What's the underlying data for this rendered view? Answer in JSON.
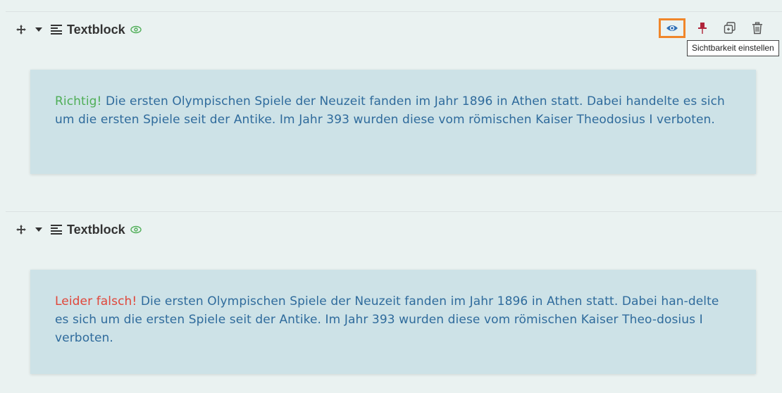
{
  "colors": {
    "accent": "#f0862a",
    "correct": "#4fae57",
    "wrong": "#e0463a",
    "text": "#2f6b9c",
    "card": "#cde2e7"
  },
  "blocks": [
    {
      "title": "Textblock",
      "icons": [
        "move-icon",
        "chevron-down-icon",
        "paragraph-icon",
        "eye-icon"
      ],
      "prefix": "Richtig!",
      "text": " Die ersten Olympischen Spiele der Neuzeit fanden im Jahr 1896 in Athen statt. Dabei handelte es sich um die ersten Spiele seit der Antike. Im Jahr 393 wurden diese vom römischen Kaiser Theodosius I verboten.",
      "toolbar": [
        "eye-icon",
        "pin-icon",
        "copy-icon",
        "trash-icon"
      ],
      "tooltip": "Sichtbarkeit einstellen"
    },
    {
      "title": "Textblock",
      "icons": [
        "move-icon",
        "chevron-down-icon",
        "paragraph-icon",
        "eye-icon"
      ],
      "prefix": "Leider falsch!",
      "text": " Die ersten Olympischen Spiele der Neuzeit fanden im Jahr 1896 in Athen statt. Dabei han-delte es sich um die ersten Spiele seit der Antike. Im Jahr 393 wurden diese vom römischen Kaiser Theo-dosius I verboten."
    }
  ]
}
